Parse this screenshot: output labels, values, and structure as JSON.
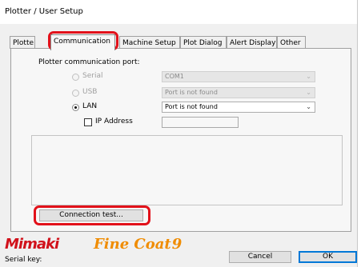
{
  "window": {
    "title": "Plotter / User Setup"
  },
  "tabs": [
    {
      "label": "Plotte"
    },
    {
      "label": "Communication"
    },
    {
      "label": "Machine Setup"
    },
    {
      "label": "Plot Dialog"
    },
    {
      "label": "Alert Display"
    },
    {
      "label": "Other"
    }
  ],
  "communication": {
    "port_label": "Plotter communication port:",
    "serial": {
      "label": "Serial",
      "value": "COM1"
    },
    "usb": {
      "label": "USB",
      "value": "Port is not found"
    },
    "lan": {
      "label": "LAN",
      "value": "Port is not found"
    },
    "ip_label": "IP Address",
    "ip_value": ""
  },
  "buttons": {
    "connection_test": "Connection test...",
    "cancel": "Cancel",
    "ok": "OK"
  },
  "brand": {
    "logo": "Mimaki",
    "product_a": "Fine Coat",
    "product_b": "9",
    "logo_color": "#d1111b",
    "product_color": "#f08c00"
  },
  "footer": {
    "serial_key_label": "Serial key:"
  },
  "highlight_color": "#e2111a"
}
